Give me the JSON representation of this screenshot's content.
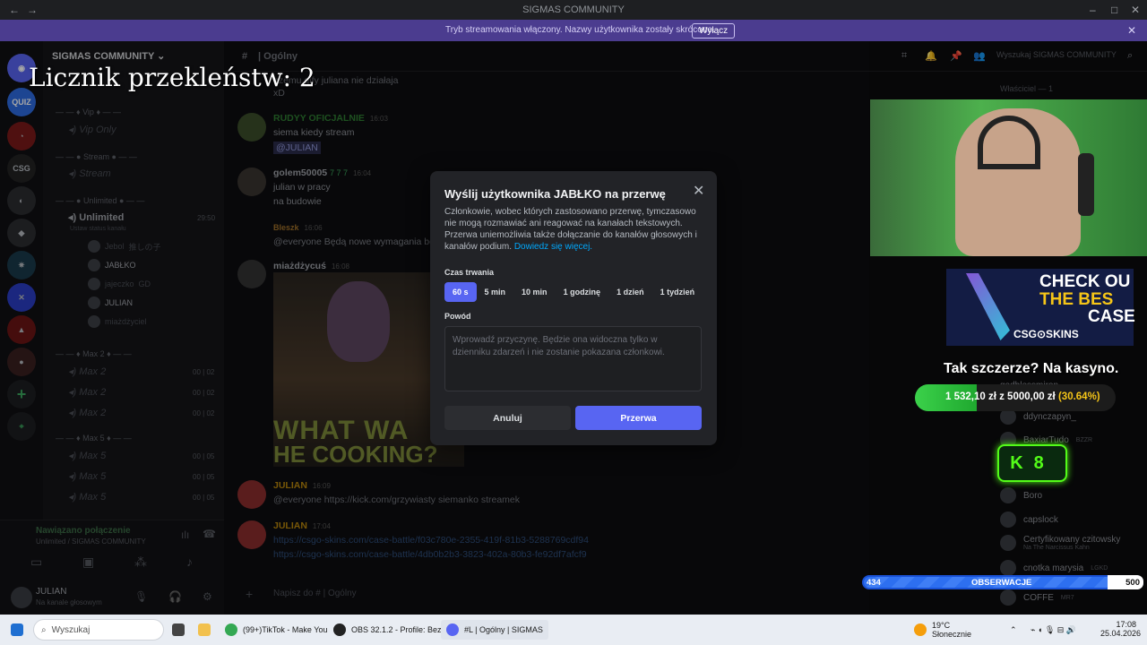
{
  "window": {
    "title": "SIGMAS COMMUNITY"
  },
  "stream_banner": {
    "message": "Tryb streamowania włączony. Nazwy użytkownika zostały skrócone.",
    "button": "Wyłącz"
  },
  "server": {
    "name": "SIGMAS COMMUNITY"
  },
  "channel_header": {
    "name": "Ogólny",
    "search_placeholder": "Wyszukaj SIGMAS COMMUNITY"
  },
  "channels": {
    "vip_cat": "Vip",
    "vip_only": "Vip Only",
    "stream_cat": "Stream",
    "stream_ch": "Stream",
    "unlimited_cat": "Unlimited",
    "unlimited_ch": "Unlimited",
    "unlimited_timer": "29:50",
    "unlimited_status": "Ustaw status kanału",
    "members": [
      {
        "name": "Jebol",
        "tag": "推しの子"
      },
      {
        "name": "JABŁKO",
        "tag": ""
      },
      {
        "name": "jajeczko",
        "tag": "GD"
      },
      {
        "name": "JULIAN",
        "tag": ""
      },
      {
        "name": "miażdżyciel",
        "tag": ""
      }
    ],
    "max2_cat": "Max 2",
    "max2": [
      "Max 2",
      "Max 2",
      "Max 2"
    ],
    "max5_cat": "Max 5",
    "max5": [
      "Max 5",
      "Max 5",
      "Max 5"
    ],
    "timer_00": "00",
    "timer_02": "02",
    "timer_05": "05"
  },
  "voice": {
    "status": "Nawiązano połączenie",
    "detail": "Unlimited / SIGMAS COMMUNITY"
  },
  "user": {
    "name": "JULIAN",
    "status": "Na kanale głosowym"
  },
  "messages": {
    "top_text": "ezemu gify juliana nie działaja",
    "top_text2": "xD",
    "m1_author": "RUDYY OFICJALNIE",
    "m1_time": "16:03",
    "m1_text": "siema kiedy stream",
    "m1_mention": "@JULIAN",
    "m2_author": "golem50005",
    "m2_tag": "7 7 7",
    "m2_time": "16:04",
    "m2_text": "julian w pracy",
    "m2_text2": "na budowie",
    "m3_author": "Bleszk",
    "m3_time": "16:06",
    "m3_text": "@everyone Będą nowe wymagania bo",
    "m4_author": "miażdżycuś",
    "m4_time": "16:08",
    "gif_caption1": "WHAT WA",
    "gif_caption2": "HE COOKING?",
    "m5_author": "JULIAN",
    "m5_time": "16:09",
    "m5_text": "@everyone https://kick.com/grzywiasty siemanko streamek",
    "m6_author": "JULIAN",
    "m6_time": "17:04",
    "m6_link1": "https://csgo-skins.com/case-battle/f03c780e-2355-419f-81b3-5288769cdf94",
    "m6_link2": "https://csgo-skins.com/case-battle/4db0b2b3-3823-402a-80b3-fe92df7afcf9",
    "input_placeholder": "Napisz do # | Ogólny"
  },
  "modal": {
    "title": "Wyślij użytkownika JABŁKO na przerwę",
    "description": "Członkowie, wobec których zastosowano przerwę, tymczasowo nie mogą rozmawiać ani reagować na kanałach tekstowych. Przerwa uniemożliwia także dołączanie do kanałów głosowych i kanałów podium.",
    "learn_more": "Dowiedz się więcej.",
    "duration_label": "Czas trwania",
    "durations": [
      "60 s",
      "5 min",
      "10 min",
      "1 godzinę",
      "1 dzień",
      "1 tydzień"
    ],
    "selected_duration": "60 s",
    "reason_label": "Powód",
    "reason_placeholder": "Wprowadź przyczynę. Będzie ona widoczna tylko w dzienniku zdarzeń i nie zostanie pokazana członkowi.",
    "cancel": "Anuluj",
    "confirm": "Przerwa"
  },
  "overlay": {
    "curse_counter": "Licznik przekleństw: 2",
    "ad_line1": "CHECK OU",
    "ad_line2": "THE BES",
    "ad_line3": "CASE",
    "ad_brand": "CSG⊙SKINS",
    "casino_text": "Tak szczerze? Na kasyno.",
    "progress_text": "1 532,10 zł z 5000,00 zł",
    "progress_pct": "(30.64%)",
    "progress_fraction": 0.3064,
    "kick_code": "K8",
    "watch_count": "434",
    "watch_label": "OBSERWACJE",
    "watch_goal": "500"
  },
  "member_list": {
    "owner_header": "Właściciel — 1",
    "items": [
      {
        "name": "godblessmiron",
        "sub": ""
      },
      {
        "name": "ddynczapyn_",
        "sub": ""
      },
      {
        "name": "BaxiarTudo",
        "sub": "BZZR"
      },
      {
        "name": "Boro",
        "sub": ""
      },
      {
        "name": "capslock",
        "sub": ""
      },
      {
        "name": "Certyfikowany czitowsky",
        "sub": "Na The Narcissus Kahn"
      },
      {
        "name": "cnotka marysia",
        "sub": "LGKD"
      },
      {
        "name": "COFFE",
        "sub": "MR7"
      }
    ]
  },
  "taskbar": {
    "search": "Wyszukaj",
    "apps": [
      {
        "label": "(99+)TikTok - Make You"
      },
      {
        "label": "OBS 32.1.2 - Profile: Bez"
      },
      {
        "label": "#L  | Ogólny | SIGMAS"
      }
    ],
    "weather_temp": "19°C",
    "weather_desc": "Słonecznie",
    "time": "17:08",
    "date": "25.04.2026"
  }
}
